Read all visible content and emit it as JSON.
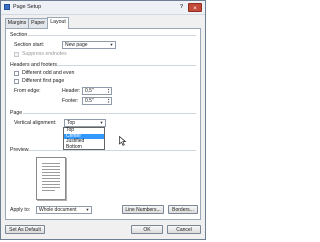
{
  "window": {
    "title": "Page Setup",
    "help_label": "?",
    "close_label": "×"
  },
  "tabs": [
    {
      "label": "Margins",
      "active": false
    },
    {
      "label": "Paper",
      "active": false
    },
    {
      "label": "Layout",
      "active": true
    }
  ],
  "section": {
    "heading": "Section",
    "start_label": "Section start:",
    "start_value": "New page",
    "suppress_endnotes_label": "Suppress endnotes",
    "suppress_endnotes_checked": false,
    "suppress_endnotes_enabled": false
  },
  "headers_footers": {
    "heading": "Headers and footers",
    "odd_even_label": "Different odd and even",
    "odd_even_checked": false,
    "first_page_label": "Different first page",
    "first_page_checked": false,
    "from_edge_label": "From edge:",
    "header_label": "Header:",
    "header_value": "0.5\"",
    "footer_label": "Footer:",
    "footer_value": "0.5\""
  },
  "page": {
    "heading": "Page",
    "vertical_alignment_label": "Vertical alignment:",
    "vertical_alignment_value": "Top",
    "vertical_alignment_options": [
      "Top",
      "Center",
      "Justified",
      "Bottom"
    ],
    "highlighted_option": "Center"
  },
  "preview": {
    "heading": "Preview"
  },
  "apply_to": {
    "label": "Apply to:",
    "value": "Whole document"
  },
  "buttons": {
    "line_numbers": "Line Numbers...",
    "borders": "Borders...",
    "set_default": "Set As Default",
    "ok": "OK",
    "cancel": "Cancel"
  },
  "colors": {
    "selection": "#3399ff",
    "close_button": "#c44b3a",
    "panel": "#ffffff"
  }
}
